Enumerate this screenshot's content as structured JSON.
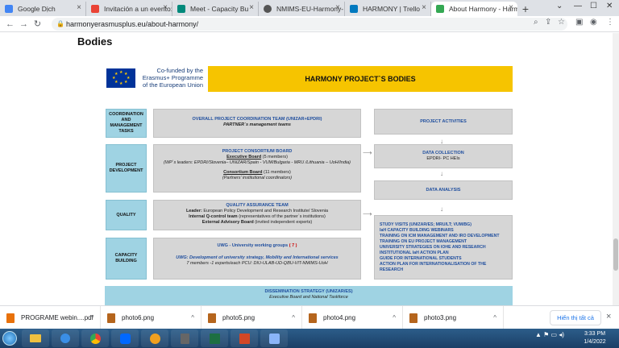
{
  "browser": {
    "tabs": [
      {
        "title": "Google Dịch",
        "color": "#4285f4"
      },
      {
        "title": "Invitación a un evento:",
        "color": "#ea4335"
      },
      {
        "title": "Meet - Capacity Bu",
        "color": "#00897b"
      },
      {
        "title": "NMIMS-EU-Harmony-",
        "color": "#555555"
      },
      {
        "title": "HARMONY | Trello",
        "color": "#0079bf"
      },
      {
        "title": "About Harmony - Harm",
        "color": "#34a853"
      }
    ],
    "url": "harmonyerasmusplus.eu/about-harmony/"
  },
  "page": {
    "heading": "Bodies",
    "diagram": {
      "cofund": [
        "Co-funded by the",
        "Erasmus+ Programme",
        "of the European Union"
      ],
      "banner": "HARMONY PROJECT`S BODIES",
      "left": [
        "COORDINATION AND MANAGEMENT TASKS",
        "PROJECT DEVELOPMENT",
        "QUALITY",
        "CAPACITY BUILDING"
      ],
      "coord": {
        "title": "OVERALL PROJECT COORDINATION TEAM (UNIZAR+EPDRI)",
        "sub": "PARTNER`s management teams"
      },
      "consortium": {
        "title": "PROJECT CONSORTIUM BOARD",
        "exec": "Executive Board",
        "exec_count": "(5 members)",
        "exec_note": "(WP`s leaders: EPDRI/Slovenia– UNIZAR/Spain - VUM/Bulgaria - MRU /Lithuania – UoH/India)",
        "cons": "Consortium Board",
        "cons_count": "(11 members)",
        "cons_note": "(Partners’ institutional coordinators)"
      },
      "quality": {
        "title": "QUALITY ASSURANCE TEAM",
        "leader_label": "Leader:",
        "leader": "European Policy Development and Research Institute/ Slovenia",
        "internal_label": "Internal Q-control team",
        "internal": "(representatives of the partner`s institutions)",
        "external_label": "External Advisory Board",
        "external": "(invited independent experts)"
      },
      "uwg": {
        "title": "UWG - University working groups",
        "count": "( 7 )",
        "line1": "UWG: Development of university strategy, Mobility and International services",
        "line2": "7 members -1 experts/each PCU: DIU-ULAB-UD-QBU-VIT-NMIMS-UoH"
      },
      "right": {
        "activities": "PROJECT ACTIVITIES",
        "collection": "DATA COLLECTION",
        "collection_sub": "EPDRI- PC HEIs",
        "analysis": "DATA ANALYSIS",
        "bullets": [
          "STUDY VISITS (UNIZAR/ES; MRU/LT; VUM/BG)",
          "IaH CAPACITY BUILDING WEBINARS",
          "TRAINING ON ICM MANAGEMENT AND IRO DEVELOPMENT",
          "TRAINING ON EU PROJECT MANAGEMENT",
          "UNIVERSITY STRATEGIES ON IOHE AND RESEARCH",
          "INSTITUTIONAL IaH ACTION PLAN",
          "GUIDE FOR INTERNATIONAL STUDENTS",
          "ACTION PLAN FOR INTERNATIONALISATION OF THE RESEARCH"
        ]
      },
      "dissemination": {
        "title": "DISSEMINATION STRATEGY (UNIZAR/ES)",
        "sub": "Executive Board and National Taskforce"
      }
    }
  },
  "downloads": {
    "items": [
      {
        "name": "PROGRAME webin....pdf",
        "color": "#e8710a"
      },
      {
        "name": "photo6.png",
        "color": "#b5651d"
      },
      {
        "name": "photo5.png",
        "color": "#b5651d"
      },
      {
        "name": "photo4.png",
        "color": "#b5651d"
      },
      {
        "name": "photo3.png",
        "color": "#b5651d"
      }
    ],
    "show_all": "Hiển thị tất cả"
  },
  "taskbar": {
    "time": "3:33 PM",
    "date": "1/4/2022"
  }
}
